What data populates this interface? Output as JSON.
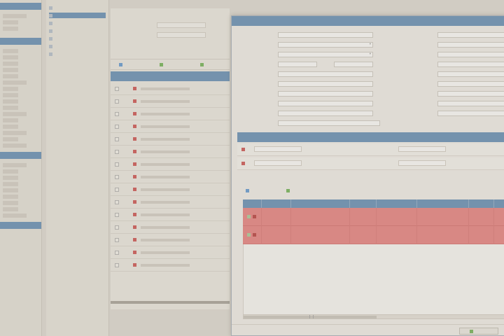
{
  "left_panel": {
    "sections": [
      {
        "rows": 3
      },
      {
        "rows": 16
      },
      {
        "rows": 12
      }
    ]
  },
  "nav": {
    "items": [
      {
        "label": "",
        "selected": false
      },
      {
        "label": "",
        "selected": true
      },
      {
        "label": "",
        "selected": false
      },
      {
        "label": "",
        "selected": false
      },
      {
        "label": "",
        "selected": false
      },
      {
        "label": "",
        "selected": false
      },
      {
        "label": "",
        "selected": false
      }
    ]
  },
  "main": {
    "toolbar": [
      {
        "label": "",
        "icon": "add-icon",
        "color": "#4a8ad0"
      },
      {
        "label": "",
        "icon": "edit-icon",
        "color": "#5caa3e"
      },
      {
        "label": "",
        "icon": "delete-icon",
        "color": "#5caa3e"
      }
    ],
    "grid_header": "",
    "row_count": 15
  },
  "dialog": {
    "title": "",
    "ok_label": "",
    "address_headers": [
      "",
      ""
    ],
    "address_rows": [
      {
        "a": "",
        "b": ""
      },
      {
        "a": "",
        "b": ""
      }
    ],
    "toolbar2": [
      {
        "label": "",
        "color": "#4a8ad0"
      },
      {
        "label": "",
        "color": "#5caa3e"
      }
    ],
    "red_rows": 2
  },
  "colors": {
    "accent": "#4e7fae",
    "error_row": "#e76f6f",
    "flag_red": "#c83a3a"
  }
}
